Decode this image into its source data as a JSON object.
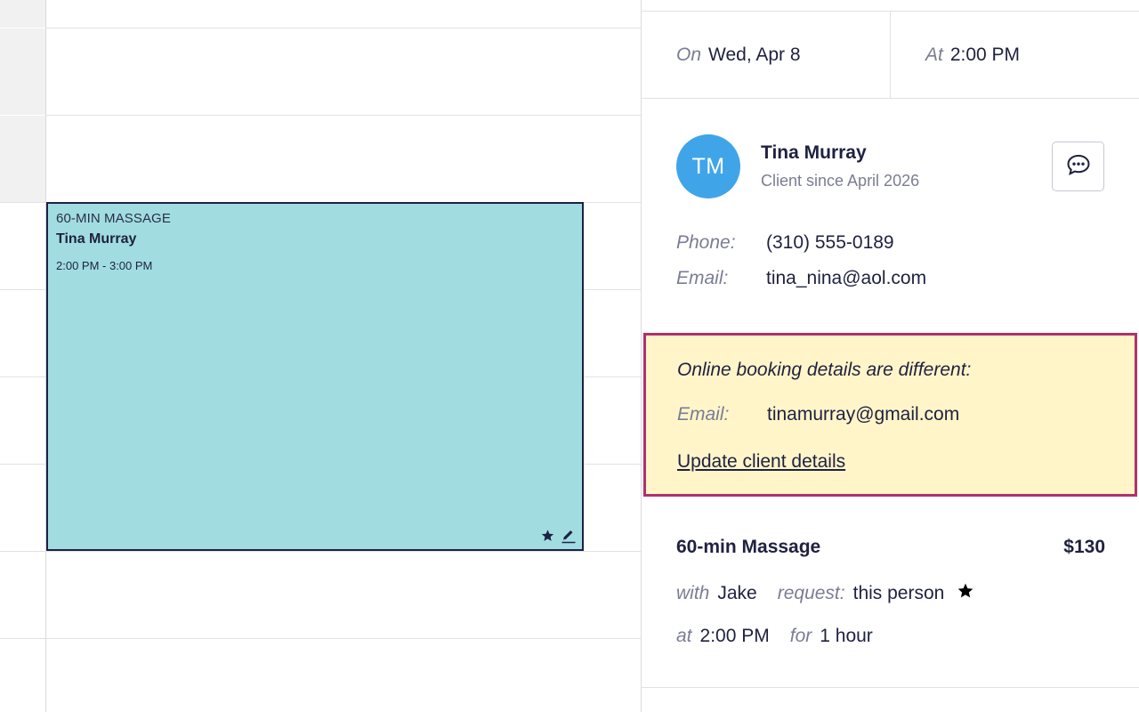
{
  "calendar": {
    "appointment": {
      "service": "60-MIN MASSAGE",
      "client": "Tina Murray",
      "time": "2:00 PM - 3:00 PM",
      "color": "#a1dde0",
      "icons": [
        "star-icon",
        "pencil-icon"
      ]
    }
  },
  "details": {
    "on_label": "On",
    "date": "Wed, Apr 8",
    "at_label": "At",
    "time": "2:00 PM",
    "client": {
      "initials": "TM",
      "name": "Tina Murray",
      "since": "Client since April 2026",
      "avatar_color": "#3fa5e8",
      "phone_label": "Phone:",
      "phone": "(310) 555-0189",
      "email_label": "Email:",
      "email": "tina_nina@aol.com",
      "message_icon": "chat-bubble-icon"
    },
    "booking_alert": {
      "title": "Online booking details are different:",
      "email_label": "Email:",
      "email": "tinamurray@gmail.com",
      "link": "Update client details",
      "background": "#fff5c9",
      "border_color": "#b1306c"
    },
    "service": {
      "name": "60-min Massage",
      "price": "$130",
      "with_label": "with",
      "staff": "Jake",
      "request_label": "request:",
      "request_value": "this person",
      "at_label": "at",
      "start": "2:00 PM",
      "for_label": "for",
      "duration": "1 hour"
    }
  }
}
